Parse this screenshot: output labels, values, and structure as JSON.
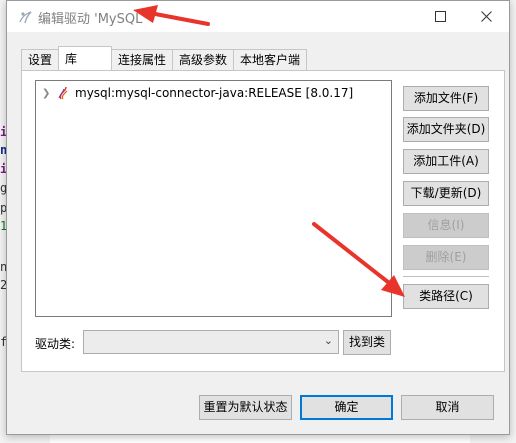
{
  "dialog": {
    "title": "编辑驱动 'MySQL"
  },
  "tabs": [
    {
      "label": "设置",
      "active": false
    },
    {
      "label": "库",
      "active": true
    },
    {
      "label": "连接属性",
      "active": false
    },
    {
      "label": "高级参数",
      "active": false
    },
    {
      "label": "本地客户端",
      "active": false
    }
  ],
  "library": {
    "items": [
      {
        "label": "mysql:mysql-connector-java:RELEASE [8.0.17]",
        "icon": "jar-icon"
      }
    ]
  },
  "side_buttons": {
    "add_file": "添加文件(F)",
    "add_folder": "添加文件夹(D)",
    "add_artifact": "添加工件(A)",
    "download_update": "下载/更新(D)",
    "info": "信息(I)",
    "delete": "删除(E)",
    "classpath": "类路径(C)"
  },
  "driver_class": {
    "label": "驱动类:",
    "value": "",
    "find_button": "找到类"
  },
  "bottom_buttons": {
    "reset": "重置为默认状态",
    "ok": "确定",
    "cancel": "取消"
  },
  "background": {
    "gutter_chars": [
      "i",
      "n",
      "i",
      "g",
      "p",
      "1",
      "",
      "",
      "n",
      "2",
      "",
      "",
      "",
      "",
      "f"
    ]
  },
  "colors": {
    "accent": "#0078d7",
    "annotation_arrow": "#e8342a"
  }
}
